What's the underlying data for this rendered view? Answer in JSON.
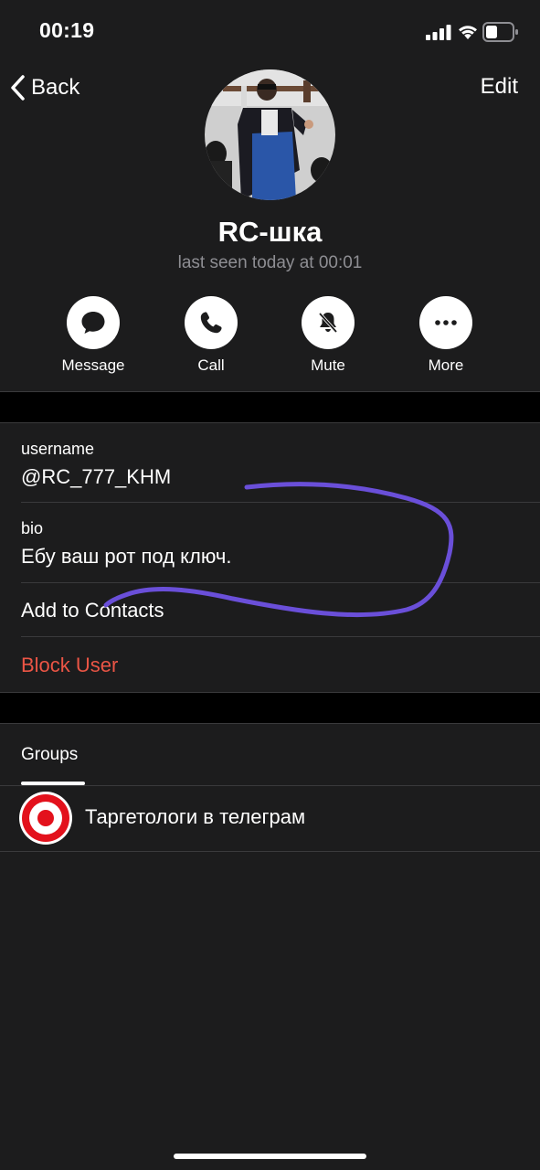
{
  "status_bar": {
    "time": "00:19"
  },
  "nav": {
    "back_label": "Back",
    "edit_label": "Edit"
  },
  "profile": {
    "name": "RC-шка",
    "last_seen": "last seen today at 00:01"
  },
  "actions": [
    {
      "label": "Message",
      "icon": "message-icon"
    },
    {
      "label": "Call",
      "icon": "phone-icon"
    },
    {
      "label": "Mute",
      "icon": "bell-slash-icon"
    },
    {
      "label": "More",
      "icon": "more-icon"
    }
  ],
  "info": {
    "username_label": "username",
    "username_value": "@RC_777_KHM",
    "bio_label": "bio",
    "bio_value": "Ебу ваш рот под ключ."
  },
  "rows": {
    "add_contact": "Add to Contacts",
    "block_user": "Block User"
  },
  "groups": {
    "title": "Groups",
    "items": [
      {
        "name": "Таргетологи в телеграм",
        "icon": "target-icon"
      }
    ]
  },
  "colors": {
    "background": "#1c1c1d",
    "danger": "#eb5545",
    "annotation_stroke": "#6a4fd9"
  }
}
